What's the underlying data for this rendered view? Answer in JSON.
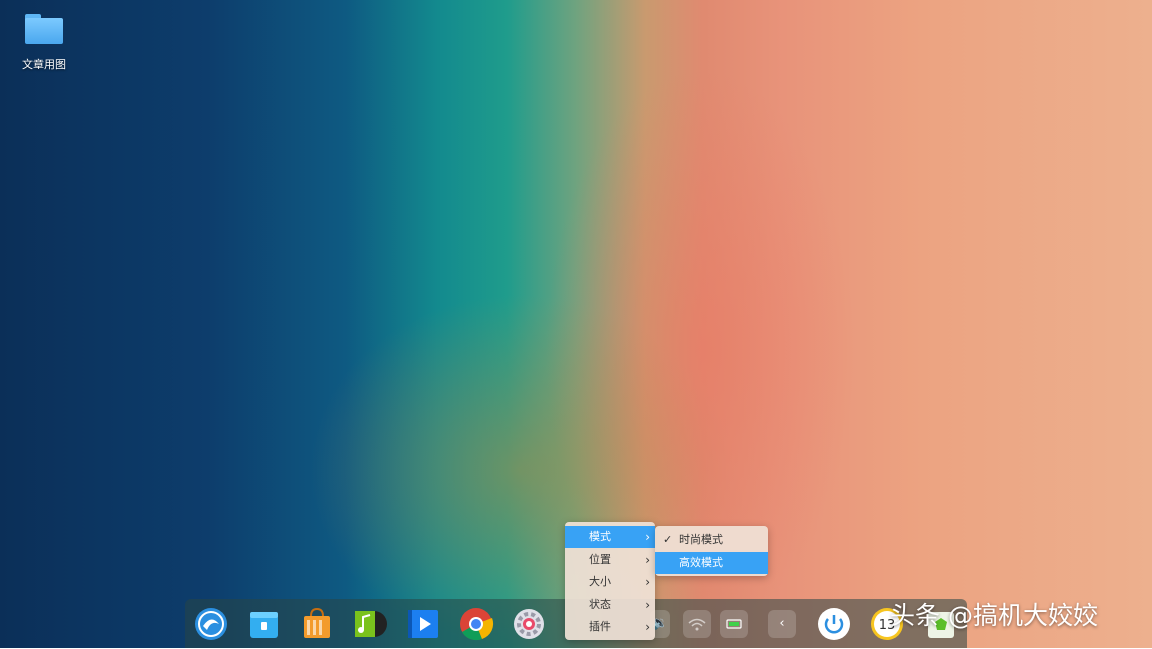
{
  "desktop": {
    "folder_label": "文章用图"
  },
  "dock_apps": [
    {
      "name": "launcher-icon",
      "color": "#2b8fe0"
    },
    {
      "name": "file-manager-icon",
      "color": "#33aef0"
    },
    {
      "name": "app-store-icon",
      "color": "#f39b2c"
    },
    {
      "name": "music-icon",
      "color": "#7ac21d"
    },
    {
      "name": "movie-icon",
      "color": "#1c7ff0"
    },
    {
      "name": "chrome-icon",
      "color": "#db4437"
    },
    {
      "name": "settings-icon",
      "color": "#e94a6a"
    }
  ],
  "context_menu": {
    "items": [
      "模式",
      "位置",
      "大小",
      "状态",
      "插件"
    ],
    "arrow": "›"
  },
  "submenu": {
    "items": [
      {
        "label": "时尚模式",
        "checked": true
      },
      {
        "label": "高效模式",
        "checked": false
      }
    ],
    "check_mark": "✓"
  },
  "tray": {
    "collapse": "‹"
  },
  "clock": {
    "text": "13"
  },
  "watermark": "头条 @搞机大姣姣"
}
